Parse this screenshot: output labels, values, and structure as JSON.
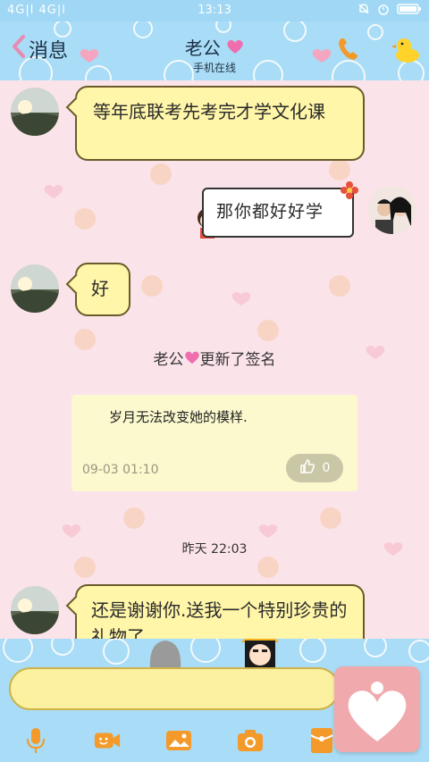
{
  "status_bar": {
    "left": "4G|l 4G|l",
    "time": "13:13"
  },
  "header": {
    "back_label": "消息",
    "title": "老公",
    "subtitle": "手机在线"
  },
  "messages": [
    {
      "from": "other",
      "text": "等年底联考先考完才学文化课"
    },
    {
      "from": "me",
      "text": "那你都好好学"
    },
    {
      "from": "other",
      "text": "好"
    }
  ],
  "system": {
    "signature_notice_name": "老公",
    "signature_notice_suffix": "更新了签名"
  },
  "signature_card": {
    "text": "岁月无法改变她的模样.",
    "date": "09-03 01:10",
    "likes": "0"
  },
  "time_divider": "昨天 22:03",
  "last_message": {
    "text": "还是谢谢你.送我一个特别珍贵的礼物了"
  },
  "icons": {
    "back": "chevron-left-icon",
    "call": "phone-icon",
    "duck": "duck-icon",
    "toolbar": [
      "microphone-icon",
      "video-icon",
      "image-icon",
      "camera-icon",
      "red-envelope-icon",
      "emoji-icon"
    ]
  },
  "colors": {
    "sky": "#a9dcf6",
    "bubble": "#fff6a9",
    "pink_bg": "#fbe3ea",
    "heart_fab": "#f0a9ad"
  }
}
